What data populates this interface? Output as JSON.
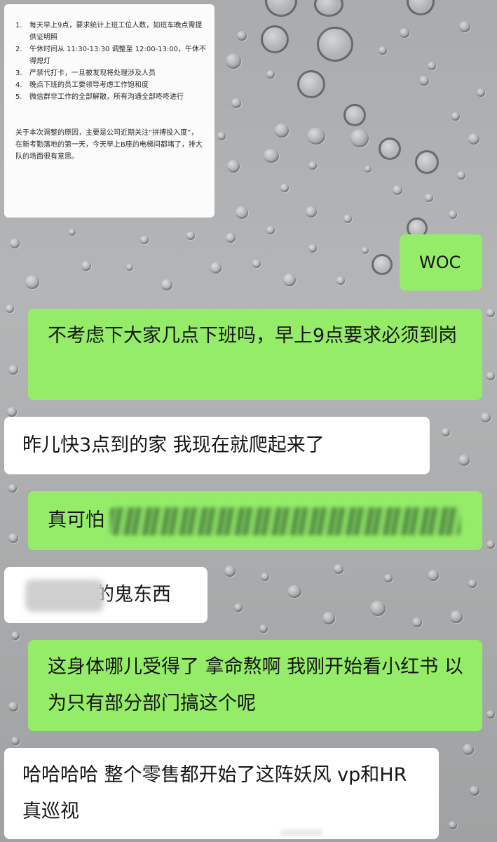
{
  "notice": {
    "items": [
      {
        "num": "1.",
        "text": "每天早上9点，要求统计上班工位人数，如班车晚点需提供证明照"
      },
      {
        "num": "2.",
        "text": "午休时间从 11:30-13:30 调整至 12:00-13:00，午休不得熄灯"
      },
      {
        "num": "3.",
        "text": "严禁代打卡，一旦被发现将处理涉及人员"
      },
      {
        "num": "4.",
        "text": "晚点下班的员工要领导考虑工作饱和度"
      },
      {
        "num": "5.",
        "text": "微信群非工作的全部解散，所有沟通全部咚咚进行"
      }
    ],
    "paragraph": "关于本次调整的原因，主要是公司近期关注“拼搏投入度”，在新考勤落地的第一天，今天早上B座的电梯间都堵了，排大队的场面很有意思。"
  },
  "messages": [
    {
      "side": "right",
      "text": "WOC"
    },
    {
      "side": "right",
      "text": "不考虑下大家几点下班吗，早上9点要求必须到岗"
    },
    {
      "side": "left",
      "text": "昨儿快3点到的家 我现在就爬起来了"
    },
    {
      "side": "right",
      "text": "真可怕"
    },
    {
      "side": "left",
      "text": "的鬼东西"
    },
    {
      "side": "right",
      "text": "这身体哪儿受得了 拿命熬啊 我刚开始看小红书 以为只有部分部门搞这个呢"
    },
    {
      "side": "left",
      "text": "哈哈哈哈 整个零售都开始了这阵妖风 vp和HR真巡视"
    }
  ],
  "colors": {
    "sent_bubble": "#95ec69",
    "received_bubble": "#ffffff",
    "background": "#aeb0b1"
  }
}
